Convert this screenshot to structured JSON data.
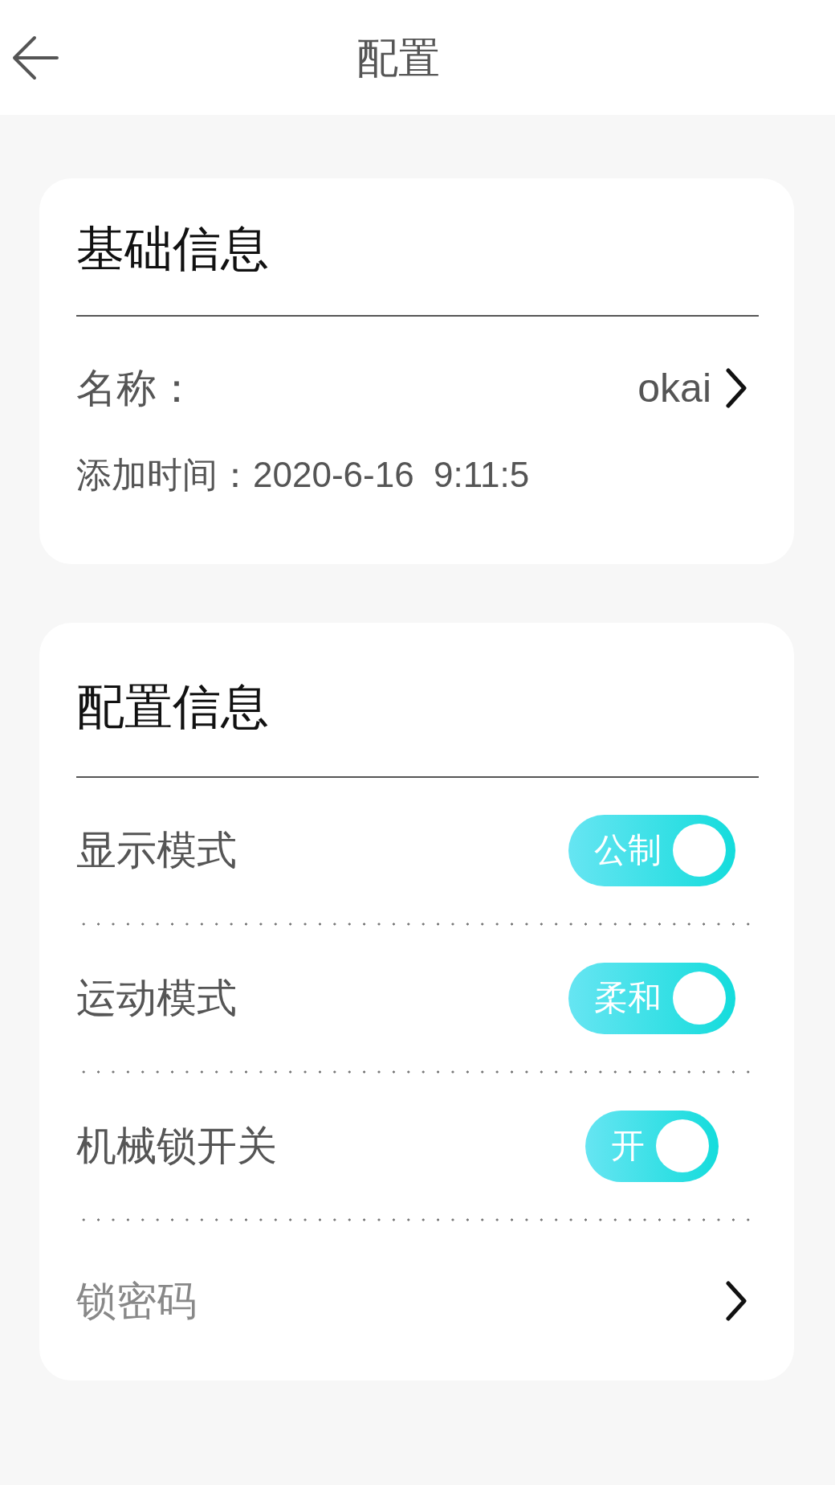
{
  "header": {
    "title": "配置"
  },
  "basic_info": {
    "title": "基础信息",
    "name_row": {
      "label": "名称：",
      "value": "okai"
    },
    "added_time": "添加时间：2020-6-16  9:11:5"
  },
  "config_info": {
    "title": "配置信息",
    "rows": [
      {
        "kind": "toggle",
        "label": "显示模式",
        "toggle_text": "公制",
        "on": true
      },
      {
        "kind": "toggle",
        "label": "运动模式",
        "toggle_text": "柔和",
        "on": true
      },
      {
        "kind": "toggle",
        "label": "机械锁开关",
        "toggle_text": "开",
        "on": true
      },
      {
        "kind": "link",
        "label": "锁密码"
      }
    ]
  }
}
